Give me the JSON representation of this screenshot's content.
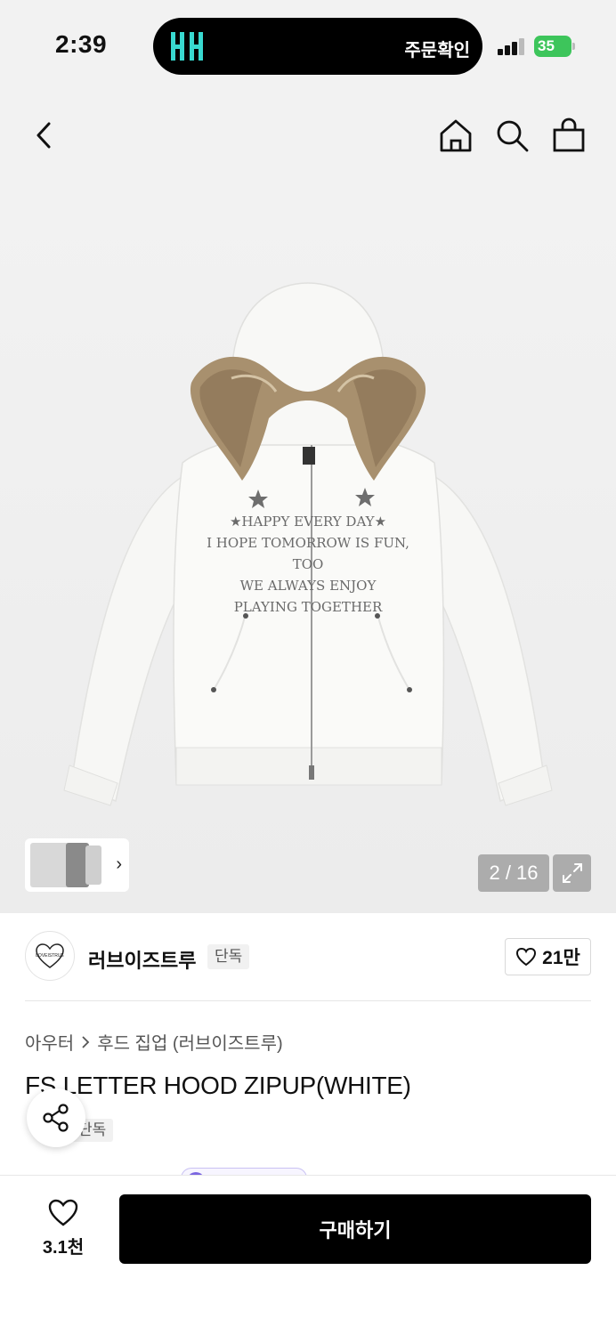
{
  "status_bar": {
    "time": "2:39",
    "island_text": "주문확인",
    "island_app_icon": "musinsa-logo-icon",
    "battery": "35",
    "battery_color": "#3dc55b"
  },
  "nav": {
    "back_icon": "chevron-left-icon",
    "home_icon": "home-icon",
    "search_icon": "search-icon",
    "cart_icon": "shopping-bag-icon"
  },
  "gallery": {
    "counter": "2 / 16",
    "expand_icon": "expand-icon",
    "thumbnail_chevron": "›"
  },
  "brand": {
    "name": "러브이즈트루",
    "badge": "단독",
    "likes": "21만"
  },
  "product": {
    "breadcrumb": [
      "아우터",
      "후드 집업 (러브이즈트루)"
    ],
    "title": "FS LETTER HOOD ZIPUP(WHITE)",
    "tag": "단독",
    "print_lines": [
      "★HAPPY EVERY DAY★",
      "I HOPE TOMORROW IS FUN, TOO",
      "WE ALWAYS ENJOY",
      "PLAYING TOGETHER"
    ]
  },
  "bottom_bar": {
    "wish_count": "3.1천",
    "buy_label": "구매하기"
  },
  "colors": {
    "accent": "#000000",
    "background": "#f2f2f2"
  }
}
